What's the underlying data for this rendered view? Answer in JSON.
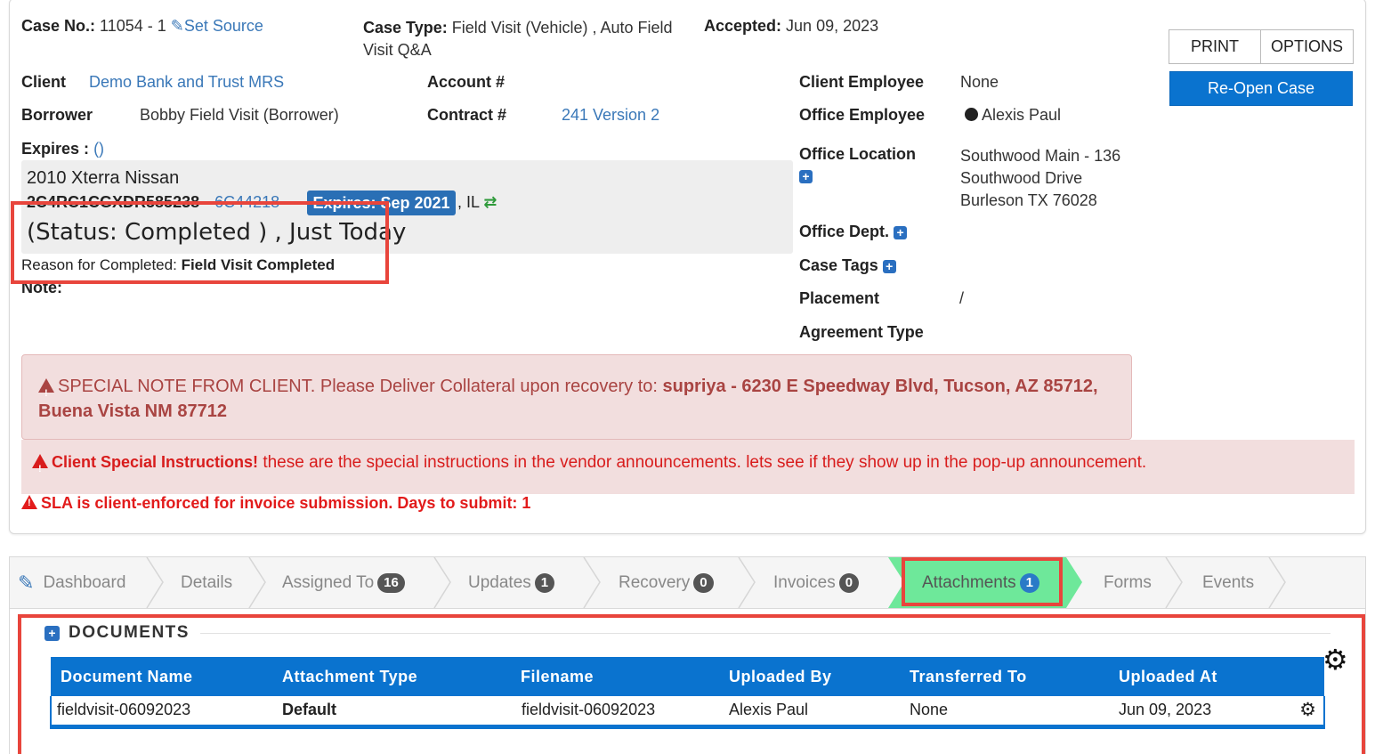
{
  "header": {
    "case_no_label": "Case No.:",
    "case_no_value": "11054 - 1",
    "set_source": "Set Source",
    "case_type_label": "Case Type:",
    "case_type_line1": "Field Visit (Vehicle) , Auto Field",
    "case_type_line2": "Visit Q&A",
    "accepted_label": "Accepted:",
    "accepted_value": "Jun 09, 2023"
  },
  "actions": {
    "print": "PRINT",
    "options": "OPTIONS",
    "reopen": "Re-Open Case"
  },
  "details": {
    "client_label": "Client",
    "client_value": "Demo Bank and Trust MRS",
    "borrower_label": "Borrower",
    "borrower_value": "Bobby Field Visit (Borrower)",
    "account_label": "Account #",
    "contract_label": "Contract #",
    "contract_value": "241 Version 2",
    "expires_label": "Expires :",
    "expires_value": "()",
    "client_employee_label": "Client Employee",
    "client_employee_value": "None",
    "office_employee_label": "Office Employee",
    "office_employee_value": "Alexis Paul",
    "office_location_label": "Office Location",
    "office_location_line1": "Southwood Main - 136",
    "office_location_line2": "Southwood Drive",
    "office_location_line3": "Burleson TX 76028",
    "office_dept_label": "Office Dept.",
    "case_tags_label": "Case Tags",
    "placement_label": "Placement",
    "placement_value": "/",
    "agreement_type_label": "Agreement Type"
  },
  "vehicle": {
    "title": "2010 Xterra Nissan",
    "vin": "2C4RC1CGXDR585238",
    "plate": "6C44218",
    "expires_badge": "Expires: Sep 2021",
    "state": ", IL",
    "status": "(Status: Completed ) , Just Today",
    "reason_label": "Reason for Completed:",
    "reason_value": "Field Visit Completed",
    "note_label": "Note:"
  },
  "alerts": {
    "special_note_text": "SPECIAL NOTE FROM CLIENT. Please Deliver Collateral upon recovery to:",
    "special_note_bold": "supriya - 6230 E Speedway Blvd, Tucson, AZ 85712,",
    "special_note_bold2": "Buena Vista NM 87712",
    "client_instr_label": "Client Special Instructions!",
    "client_instr_text": "these are the special instructions in the vendor announcements.  lets see if they show up in the pop-up announcement.",
    "sla_text": "SLA is client-enforced for invoice submission. Days to submit: 1"
  },
  "tabs": [
    {
      "label": "Dashboard"
    },
    {
      "label": "Details"
    },
    {
      "label": "Assigned To",
      "count": "16"
    },
    {
      "label": "Updates",
      "count": "1"
    },
    {
      "label": "Recovery",
      "count": "0"
    },
    {
      "label": "Invoices",
      "count": "0"
    },
    {
      "label": "Attachments",
      "count": "1"
    },
    {
      "label": "Forms"
    },
    {
      "label": "Events"
    }
  ],
  "documents": {
    "title": "DOCUMENTS",
    "columns": [
      "Document Name",
      "Attachment Type",
      "Filename",
      "Uploaded By",
      "Transferred To",
      "Uploaded At"
    ],
    "rows": [
      [
        "fieldvisit-06092023",
        "Default",
        "fieldvisit-06092023",
        "Alexis Paul",
        "None",
        "Jun 09, 2023"
      ]
    ]
  },
  "colors": {
    "primary": "#0a73cf",
    "active_tab": "#6ee89a",
    "highlight": "#e8453c",
    "alert_bg": "#f2dede"
  }
}
